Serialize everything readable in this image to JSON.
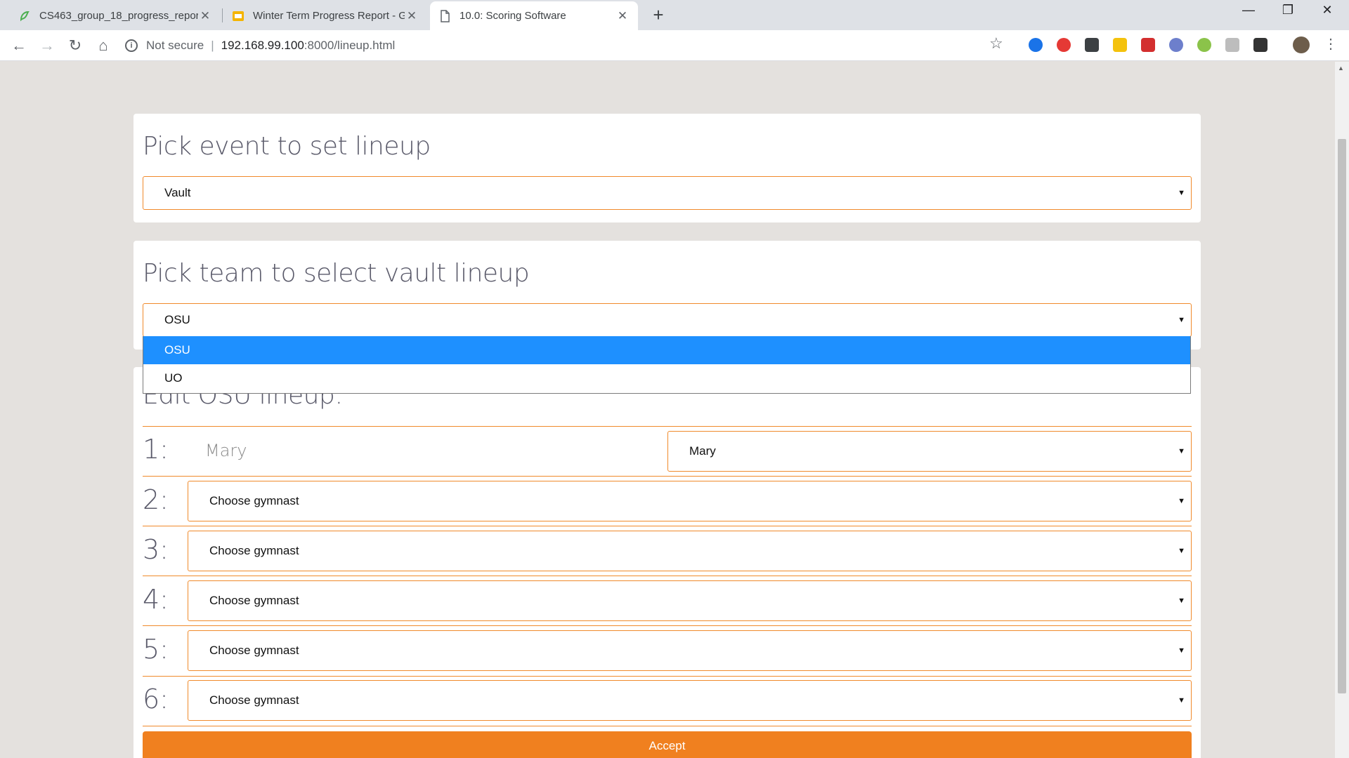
{
  "browser": {
    "tabs": [
      {
        "title": "CS463_group_18_progress_report",
        "favicon": "overleaf-icon",
        "color": "#4caf50"
      },
      {
        "title": "Winter Term Progress Report - Google Slides",
        "favicon": "slides-icon",
        "color": "#f4b400"
      },
      {
        "title": "10.0: Scoring Software",
        "favicon": "page-icon",
        "active": true
      }
    ],
    "new_tab": "+",
    "address": {
      "security_label": "Not secure",
      "host": "192.168.99.100",
      "path": ":8000/lineup.html"
    }
  },
  "event_card": {
    "title": "Pick event to set lineup",
    "selected": "Vault"
  },
  "team_card": {
    "title": "Pick team to select vault lineup",
    "selected": "OSU",
    "options": [
      "OSU",
      "UO"
    ]
  },
  "lineup_card": {
    "title": "Edit OSU lineup:",
    "rows": [
      {
        "number": "1:",
        "name": "Mary",
        "select": "Mary"
      },
      {
        "number": "2:",
        "select": "Choose gymnast"
      },
      {
        "number": "3:",
        "select": "Choose gymnast"
      },
      {
        "number": "4:",
        "select": "Choose gymnast"
      },
      {
        "number": "5:",
        "select": "Choose gymnast"
      },
      {
        "number": "6:",
        "select": "Choose gymnast"
      }
    ],
    "accept_label": "Accept"
  },
  "colors": {
    "accent": "#f08a2b",
    "button": "#f0801f",
    "dropdown_highlight": "#1e90ff"
  }
}
